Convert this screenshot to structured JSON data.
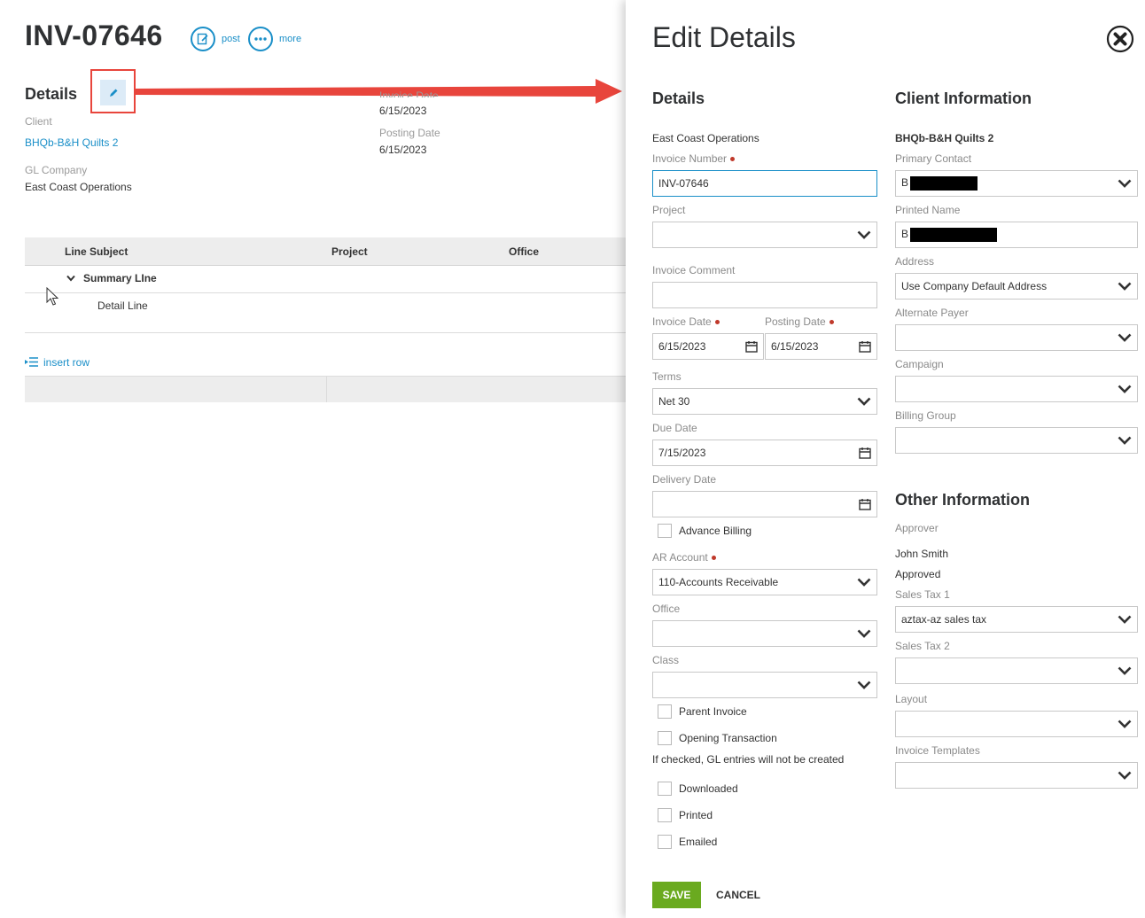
{
  "invoice": {
    "title": "INV-07646",
    "actions": {
      "post": "post",
      "more": "more"
    }
  },
  "details": {
    "title": "Details",
    "client_label": "Client",
    "client_value": "BHQb-B&H Quilts 2",
    "gl_company_label": "GL Company",
    "gl_company_value": "East Coast Operations",
    "invoice_date_label": "Invoice Date",
    "invoice_date_value": "6/15/2023",
    "posting_date_label": "Posting Date",
    "posting_date_value": "6/15/2023"
  },
  "grid": {
    "columns": [
      "Line Subject",
      "Project",
      "Office"
    ],
    "summary_line": "Summary LIne",
    "detail_line": "Detail Line",
    "insert_row": "insert row"
  },
  "panel": {
    "title": "Edit Details",
    "details_title": "Details",
    "company": "East Coast Operations",
    "invoice_number_label": "Invoice Number",
    "invoice_number_value": "INV-07646",
    "project_label": "Project",
    "invoice_comment_label": "Invoice Comment",
    "invoice_date_label": "Invoice Date",
    "invoice_date_value": "6/15/2023",
    "posting_date_label": "Posting Date",
    "posting_date_value": "6/15/2023",
    "terms_label": "Terms",
    "terms_value": "Net 30",
    "due_date_label": "Due Date",
    "due_date_value": "7/15/2023",
    "delivery_date_label": "Delivery Date",
    "advance_billing": "Advance Billing",
    "ar_account_label": "AR Account",
    "ar_account_value": "110-Accounts Receivable",
    "office_label": "Office",
    "class_label": "Class",
    "parent_invoice": "Parent Invoice",
    "opening_transaction": "Opening Transaction",
    "opening_note": "If checked, GL entries will not be created",
    "downloaded": "Downloaded",
    "printed": "Printed",
    "emailed": "Emailed",
    "client_info_title": "Client Information",
    "client_name": "BHQb-B&H Quilts 2",
    "primary_contact_label": "Primary Contact",
    "primary_contact_initial": "B",
    "printed_name_label": "Printed Name",
    "printed_name_initial": "B",
    "address_label": "Address",
    "address_value": "Use Company Default Address",
    "alternate_payer_label": "Alternate Payer",
    "campaign_label": "Campaign",
    "billing_group_label": "Billing Group",
    "other_info_title": "Other Information",
    "approver_label": "Approver",
    "approver_value": "John Smith",
    "approval_status": "Approved",
    "sales_tax1_label": "Sales Tax 1",
    "sales_tax1_value": "aztax-az sales tax",
    "sales_tax2_label": "Sales Tax 2",
    "layout_label": "Layout",
    "invoice_templates_label": "Invoice Templates",
    "save": "SAVE",
    "cancel": "CANCEL"
  },
  "colors": {
    "accent": "#1a8fc8",
    "save": "#6aaa1f",
    "annotation": "#e8453c"
  }
}
